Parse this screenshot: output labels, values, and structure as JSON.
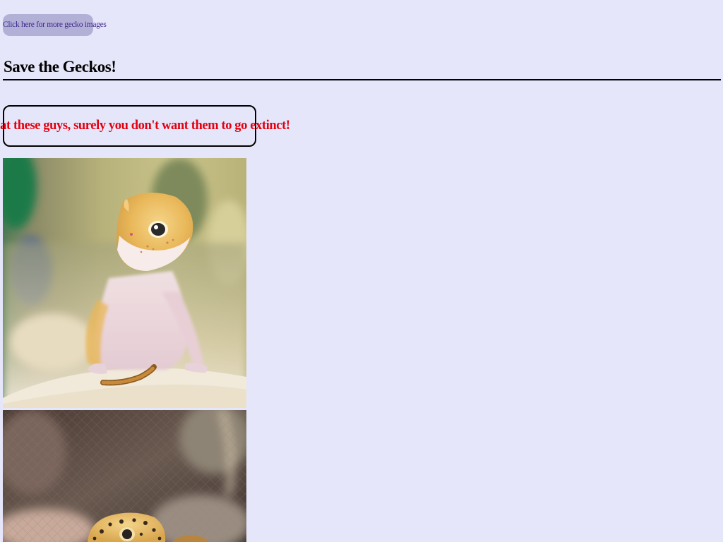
{
  "nav": {
    "more_images_label": "Click here for more gecko images"
  },
  "page": {
    "title": "Save the Geckos!",
    "callout_text": "Look at these guys, surely you don't want them to go extinct!"
  },
  "colors": {
    "background": "#e6e6fa",
    "button_background": "#b3b0d8",
    "button_text": "#3b2a88",
    "callout_text": "#e3000f"
  },
  "images": [
    {
      "subject": "leopard gecko on sand with a mealworm",
      "icon": "gecko-photo"
    },
    {
      "subject": "spotted leopard gecko in front of a mesh enclosure",
      "icon": "gecko-photo"
    }
  ]
}
